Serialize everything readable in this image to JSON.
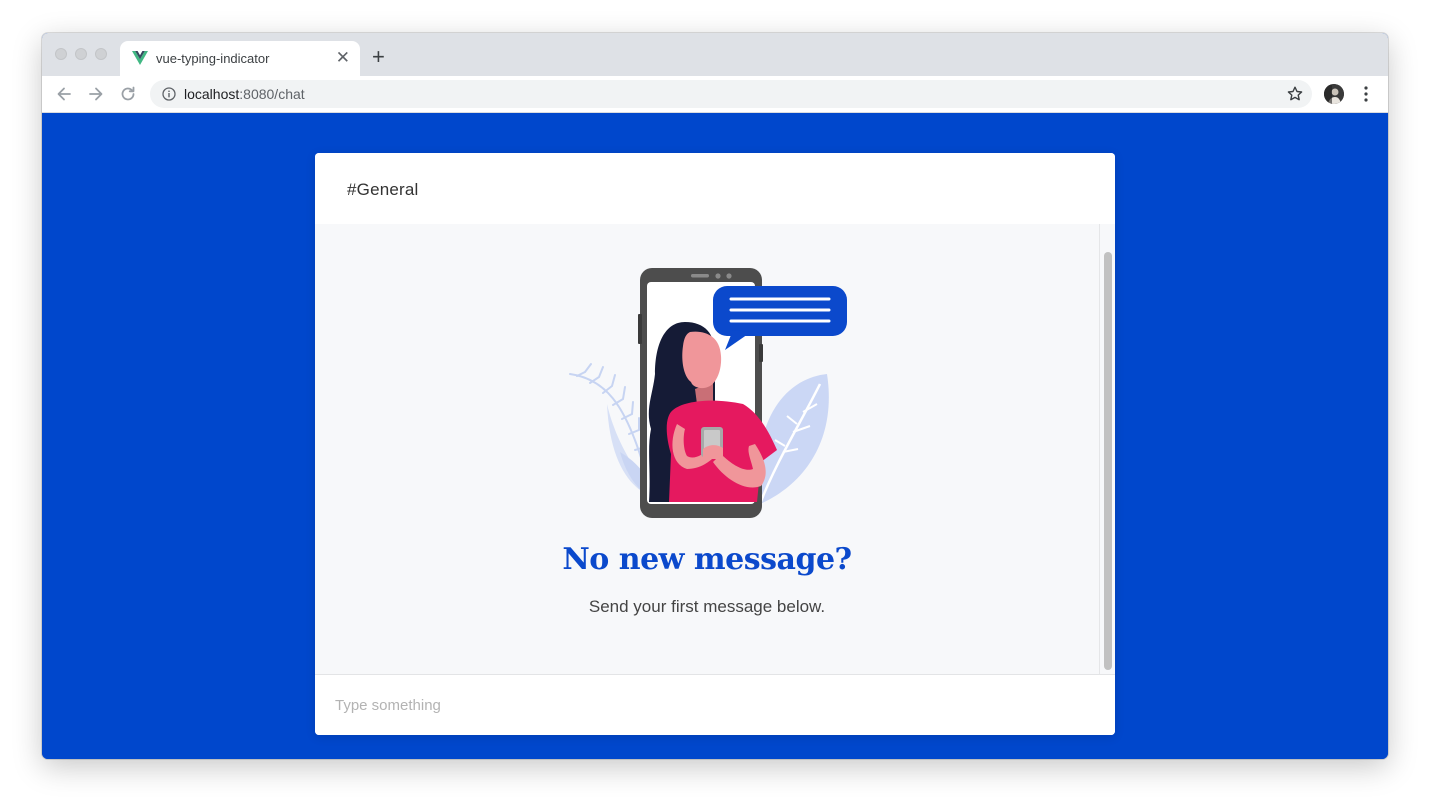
{
  "browser": {
    "tab_title": "vue-typing-indicator",
    "tab_close": "✕",
    "new_tab": "+",
    "url_host": "localhost",
    "url_path": ":8080/chat"
  },
  "chat": {
    "channel": "#General",
    "empty_title": "No new message?",
    "empty_subtitle": "Send your first message below.",
    "input_placeholder": "Type something"
  },
  "colors": {
    "page_background": "#0047cc",
    "title_color": "#0b49cc",
    "accent_pink": "#e5195f"
  },
  "icons": {
    "favicon": "vue-logo-icon",
    "back": "arrow-left-icon",
    "forward": "arrow-right-icon",
    "reload": "reload-icon",
    "info": "info-icon",
    "bookmark": "star-icon",
    "menu": "kebab-menu-icon"
  }
}
